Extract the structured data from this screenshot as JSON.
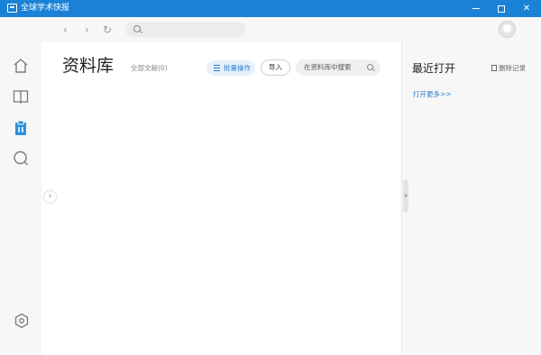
{
  "window": {
    "title": "全球学术快报"
  },
  "topbar": {
    "back_glyph": "‹",
    "forward_glyph": "›",
    "refresh_glyph": "↻",
    "search_placeholder": ""
  },
  "sidebar": {
    "items": [
      {
        "name": "home",
        "icon": "home-icon"
      },
      {
        "name": "reading",
        "icon": "book-icon"
      },
      {
        "name": "library",
        "icon": "library-icon",
        "active": true
      },
      {
        "name": "discover",
        "icon": "discover-icon"
      },
      {
        "name": "settings",
        "icon": "settings-icon"
      }
    ]
  },
  "main": {
    "title": "资料库",
    "doc_count": "全部文献(0)",
    "batch_label": "批量操作",
    "import_label": "导入",
    "search_placeholder": "在资料库中搜索",
    "expand_glyph": "›"
  },
  "recent": {
    "title": "最近打开",
    "clear_label": "删除记录",
    "open_more": "打开更多>>"
  },
  "colors": {
    "accent": "#1a82d6",
    "link": "#2a7fcf",
    "panel": "#f7f7f7"
  }
}
